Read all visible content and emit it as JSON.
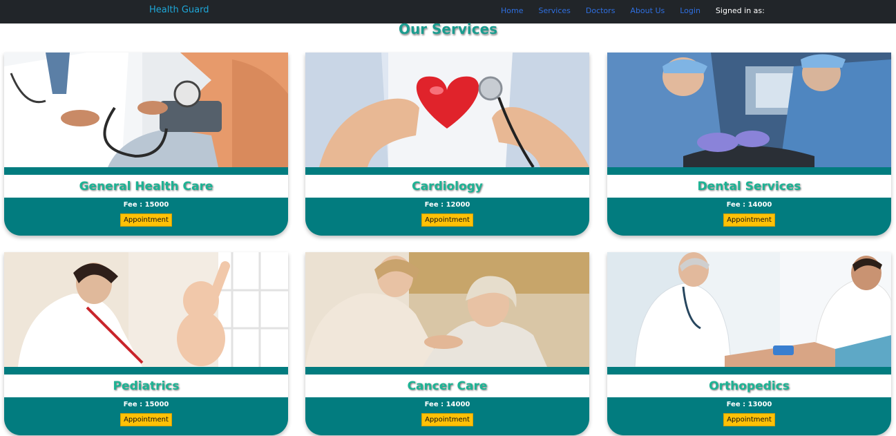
{
  "navbar": {
    "brand": "Health Guard",
    "links": [
      "Home",
      "Services",
      "Doctors",
      "About Us",
      "Login"
    ],
    "signed_in": "Signed in as:"
  },
  "section_title": "Our Services",
  "colors": {
    "teal": "#027c7f",
    "accent_yellow": "#ffc107",
    "title_green": "#1db394",
    "navbar_bg": "#212529"
  },
  "services": [
    {
      "name": "General Health Care",
      "fee": "Fee : 15000",
      "button": "Appointment",
      "image": "blood-pressure-check-photo"
    },
    {
      "name": "Cardiology",
      "fee": "Fee : 12000",
      "button": "Appointment",
      "image": "heart-stethoscope-photo"
    },
    {
      "name": "Dental Services",
      "fee": "Fee : 14000",
      "button": "Appointment",
      "image": "dentist-procedure-photo"
    },
    {
      "name": "Pediatrics",
      "fee": "Fee : 15000",
      "button": "Appointment",
      "image": "doctor-baby-checkup-photo"
    },
    {
      "name": "Cancer Care",
      "fee": "Fee : 14000",
      "button": "Appointment",
      "image": "cancer-patient-care-photo"
    },
    {
      "name": "Orthopedics",
      "fee": "Fee : 13000",
      "button": "Appointment",
      "image": "knee-examination-photo"
    }
  ]
}
